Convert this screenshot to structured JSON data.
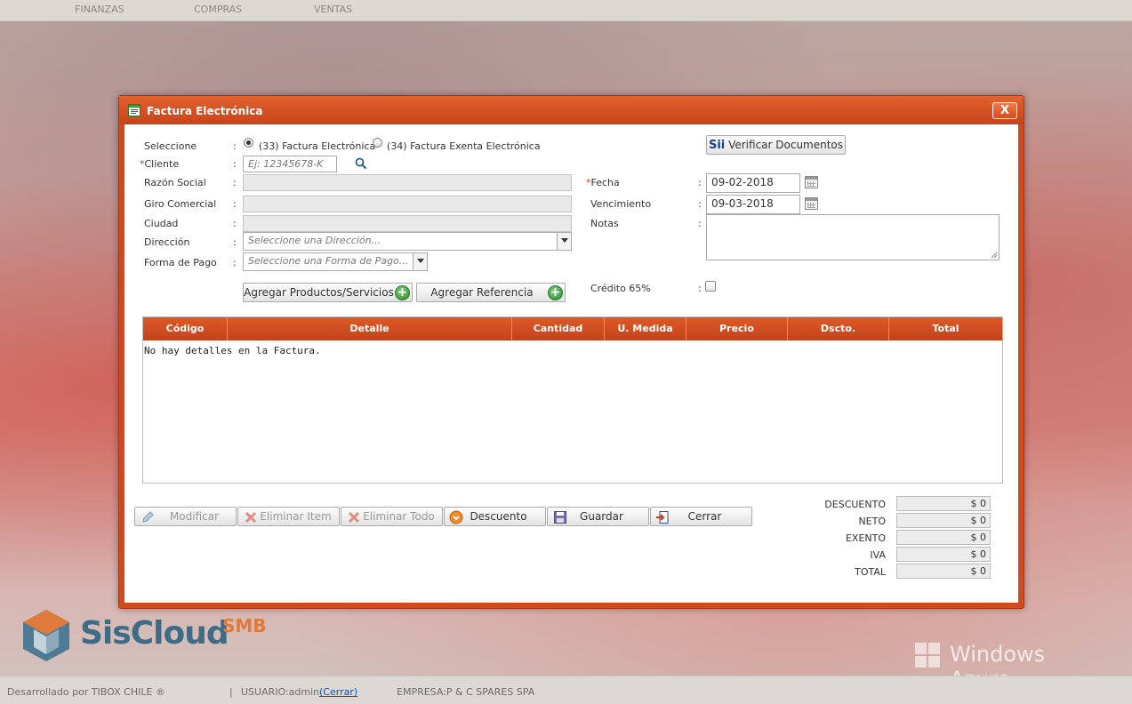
{
  "topnav": [
    "FINANZAS",
    "COMPRAS",
    "VENTAS"
  ],
  "dialog": {
    "title": "Factura Electrónica",
    "close_label": "X",
    "verify_button": "Verificar Documentos",
    "verify_logo": "Sii",
    "seleccione_label": "Seleccione",
    "radio1_label": "(33) Factura Electrónica",
    "radio2_label": "(34) Factura Exenta Electrónica",
    "cliente_label": "Cliente",
    "cliente_placeholder": "Ej: 12345678-K",
    "razon_label": "Razón Social",
    "giro_label": "Giro Comercial",
    "ciudad_label": "Ciudad",
    "direccion_label": "Dirección",
    "direccion_placeholder": "Seleccione una Dirección...",
    "pago_label": "Forma de Pago",
    "pago_placeholder": "Seleccione una Forma de Pago...",
    "fecha_label": "Fecha",
    "fecha_value": "09-02-2018",
    "vencimiento_label": "Vencimiento",
    "vencimiento_value": "09-03-2018",
    "notas_label": "Notas",
    "credito_label": "Crédito 65%",
    "colon": ":",
    "required_mark": "*",
    "add_products": "Agregar Productos/Servicios",
    "add_reference": "Agregar Referencia"
  },
  "table": {
    "headers": [
      "Código",
      "Detalle",
      "Cantidad",
      "U. Medida",
      "Precio",
      "Dscto.",
      "Total"
    ],
    "empty_message": "No hay detalles en la Factura."
  },
  "actions": {
    "modificar": "Modificar",
    "eliminar_item": "Eliminar Item",
    "eliminar_todo": "Eliminar Todo",
    "descuento": "Descuento",
    "guardar": "Guardar",
    "cerrar": "Cerrar"
  },
  "totals": [
    {
      "label": "DESCUENTO",
      "value": "$ 0"
    },
    {
      "label": "NETO",
      "value": "$ 0"
    },
    {
      "label": "EXENTO",
      "value": "$ 0"
    },
    {
      "label": "IVA",
      "value": "$ 0"
    },
    {
      "label": "TOTAL",
      "value": "$ 0"
    }
  ],
  "branding": {
    "logo": "SisCloud",
    "logo_suffix": "SMB",
    "azure": "Windows Azure"
  },
  "footer": {
    "developed": "Desarrollado por TIBOX CHILE ®",
    "separator": "|",
    "usuario": "USUARIO:admin",
    "cerrar_link": "(Cerrar)",
    "empresa": "EMPRESA:P & C SPARES SPA"
  }
}
